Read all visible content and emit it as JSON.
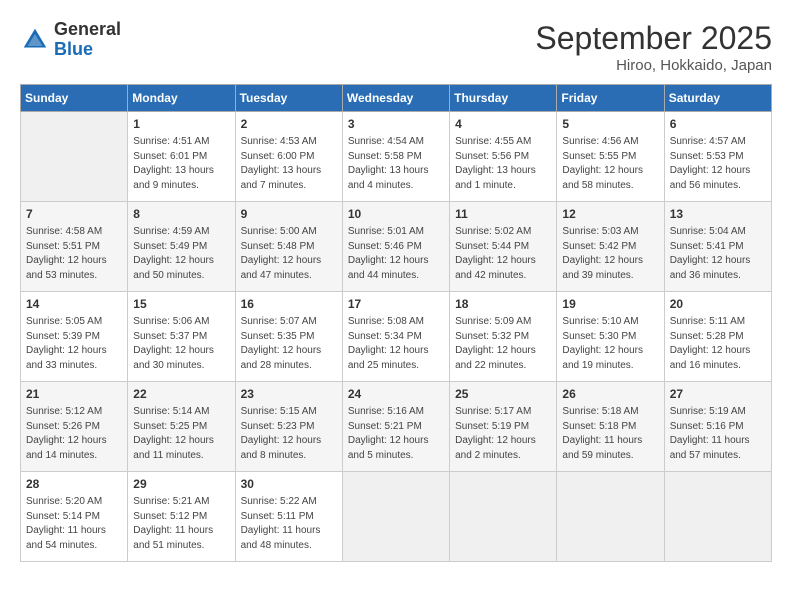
{
  "header": {
    "logo_general": "General",
    "logo_blue": "Blue",
    "month_title": "September 2025",
    "subtitle": "Hiroo, Hokkaido, Japan"
  },
  "days_of_week": [
    "Sunday",
    "Monday",
    "Tuesday",
    "Wednesday",
    "Thursday",
    "Friday",
    "Saturday"
  ],
  "weeks": [
    [
      {
        "day": "",
        "info": ""
      },
      {
        "day": "1",
        "info": "Sunrise: 4:51 AM\nSunset: 6:01 PM\nDaylight: 13 hours\nand 9 minutes."
      },
      {
        "day": "2",
        "info": "Sunrise: 4:53 AM\nSunset: 6:00 PM\nDaylight: 13 hours\nand 7 minutes."
      },
      {
        "day": "3",
        "info": "Sunrise: 4:54 AM\nSunset: 5:58 PM\nDaylight: 13 hours\nand 4 minutes."
      },
      {
        "day": "4",
        "info": "Sunrise: 4:55 AM\nSunset: 5:56 PM\nDaylight: 13 hours\nand 1 minute."
      },
      {
        "day": "5",
        "info": "Sunrise: 4:56 AM\nSunset: 5:55 PM\nDaylight: 12 hours\nand 58 minutes."
      },
      {
        "day": "6",
        "info": "Sunrise: 4:57 AM\nSunset: 5:53 PM\nDaylight: 12 hours\nand 56 minutes."
      }
    ],
    [
      {
        "day": "7",
        "info": "Sunrise: 4:58 AM\nSunset: 5:51 PM\nDaylight: 12 hours\nand 53 minutes."
      },
      {
        "day": "8",
        "info": "Sunrise: 4:59 AM\nSunset: 5:49 PM\nDaylight: 12 hours\nand 50 minutes."
      },
      {
        "day": "9",
        "info": "Sunrise: 5:00 AM\nSunset: 5:48 PM\nDaylight: 12 hours\nand 47 minutes."
      },
      {
        "day": "10",
        "info": "Sunrise: 5:01 AM\nSunset: 5:46 PM\nDaylight: 12 hours\nand 44 minutes."
      },
      {
        "day": "11",
        "info": "Sunrise: 5:02 AM\nSunset: 5:44 PM\nDaylight: 12 hours\nand 42 minutes."
      },
      {
        "day": "12",
        "info": "Sunrise: 5:03 AM\nSunset: 5:42 PM\nDaylight: 12 hours\nand 39 minutes."
      },
      {
        "day": "13",
        "info": "Sunrise: 5:04 AM\nSunset: 5:41 PM\nDaylight: 12 hours\nand 36 minutes."
      }
    ],
    [
      {
        "day": "14",
        "info": "Sunrise: 5:05 AM\nSunset: 5:39 PM\nDaylight: 12 hours\nand 33 minutes."
      },
      {
        "day": "15",
        "info": "Sunrise: 5:06 AM\nSunset: 5:37 PM\nDaylight: 12 hours\nand 30 minutes."
      },
      {
        "day": "16",
        "info": "Sunrise: 5:07 AM\nSunset: 5:35 PM\nDaylight: 12 hours\nand 28 minutes."
      },
      {
        "day": "17",
        "info": "Sunrise: 5:08 AM\nSunset: 5:34 PM\nDaylight: 12 hours\nand 25 minutes."
      },
      {
        "day": "18",
        "info": "Sunrise: 5:09 AM\nSunset: 5:32 PM\nDaylight: 12 hours\nand 22 minutes."
      },
      {
        "day": "19",
        "info": "Sunrise: 5:10 AM\nSunset: 5:30 PM\nDaylight: 12 hours\nand 19 minutes."
      },
      {
        "day": "20",
        "info": "Sunrise: 5:11 AM\nSunset: 5:28 PM\nDaylight: 12 hours\nand 16 minutes."
      }
    ],
    [
      {
        "day": "21",
        "info": "Sunrise: 5:12 AM\nSunset: 5:26 PM\nDaylight: 12 hours\nand 14 minutes."
      },
      {
        "day": "22",
        "info": "Sunrise: 5:14 AM\nSunset: 5:25 PM\nDaylight: 12 hours\nand 11 minutes."
      },
      {
        "day": "23",
        "info": "Sunrise: 5:15 AM\nSunset: 5:23 PM\nDaylight: 12 hours\nand 8 minutes."
      },
      {
        "day": "24",
        "info": "Sunrise: 5:16 AM\nSunset: 5:21 PM\nDaylight: 12 hours\nand 5 minutes."
      },
      {
        "day": "25",
        "info": "Sunrise: 5:17 AM\nSunset: 5:19 PM\nDaylight: 12 hours\nand 2 minutes."
      },
      {
        "day": "26",
        "info": "Sunrise: 5:18 AM\nSunset: 5:18 PM\nDaylight: 11 hours\nand 59 minutes."
      },
      {
        "day": "27",
        "info": "Sunrise: 5:19 AM\nSunset: 5:16 PM\nDaylight: 11 hours\nand 57 minutes."
      }
    ],
    [
      {
        "day": "28",
        "info": "Sunrise: 5:20 AM\nSunset: 5:14 PM\nDaylight: 11 hours\nand 54 minutes."
      },
      {
        "day": "29",
        "info": "Sunrise: 5:21 AM\nSunset: 5:12 PM\nDaylight: 11 hours\nand 51 minutes."
      },
      {
        "day": "30",
        "info": "Sunrise: 5:22 AM\nSunset: 5:11 PM\nDaylight: 11 hours\nand 48 minutes."
      },
      {
        "day": "",
        "info": ""
      },
      {
        "day": "",
        "info": ""
      },
      {
        "day": "",
        "info": ""
      },
      {
        "day": "",
        "info": ""
      }
    ]
  ]
}
